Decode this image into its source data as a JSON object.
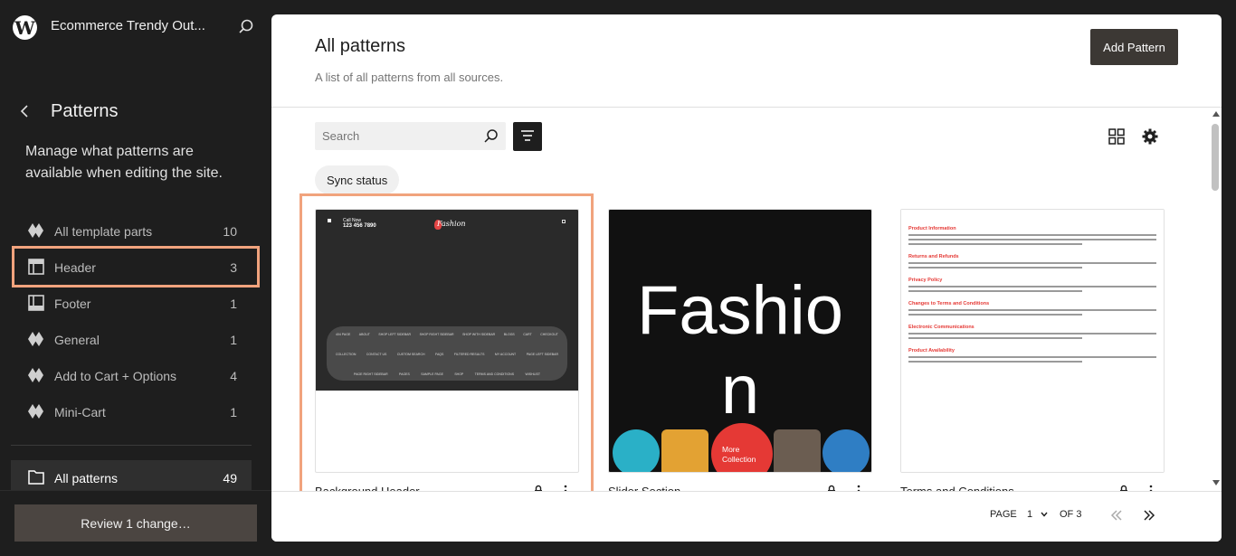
{
  "site": {
    "title": "Ecommerce Trendy Out..."
  },
  "panel": {
    "title": "Patterns",
    "description": "Manage what patterns are available when editing the site."
  },
  "nav": {
    "items": [
      {
        "label": "All template parts",
        "count": "10",
        "icon": "diamond-icon"
      },
      {
        "label": "Header",
        "count": "3",
        "icon": "header-layout-icon"
      },
      {
        "label": "Footer",
        "count": "1",
        "icon": "footer-layout-icon"
      },
      {
        "label": "General",
        "count": "1",
        "icon": "diamond-icon"
      },
      {
        "label": "Add to Cart + Options",
        "count": "4",
        "icon": "diamond-icon"
      },
      {
        "label": "Mini-Cart",
        "count": "1",
        "icon": "diamond-icon"
      }
    ],
    "all_patterns": {
      "label": "All patterns",
      "count": "49",
      "icon": "folder-icon"
    }
  },
  "review_button": "Review 1 change…",
  "main": {
    "title": "All patterns",
    "description": "A list of all patterns from all sources.",
    "add_button": "Add Pattern",
    "search_placeholder": "Search",
    "sync_chip": "Sync status"
  },
  "cards": [
    {
      "title": "Background Header",
      "preview": {
        "call_now": "Call Now",
        "phone": "123 456 7890",
        "logo": "Fashion",
        "menu_rows": [
          [
            "404 PAGE",
            "ABOUT",
            "SHOP LEFT SIDEBAR",
            "SHOP RIGHT SIDEBAR",
            "SHOP WITH SIDEBAR",
            "BLOGS",
            "CART",
            "CHECKOUT"
          ],
          [
            "COLLECTION",
            "CONTACT US",
            "CUSTOM SEARCH",
            "FAQS",
            "FILTERED RESULTS",
            "MY ACCOUNT",
            "PAGE LEFT SIDEBAR"
          ],
          [
            "PAGE RIGHT SIDEBAR",
            "PAGES",
            "SAMPLE PAGE",
            "SHOP",
            "TERMS AND CONDITIONS",
            "WISHLIST"
          ]
        ]
      }
    },
    {
      "title": "Slider Section",
      "preview": {
        "word_line1": "Fashio",
        "word_line2": "n",
        "more": "More Collection"
      }
    },
    {
      "title": "Terms and Conditions",
      "preview": {
        "sections": [
          "Product Information",
          "Returns and Refunds",
          "Privacy Policy",
          "Changes to Terms and Conditions",
          "Electronic Communications",
          "Product Availability"
        ]
      }
    }
  ],
  "pagination": {
    "page_label": "PAGE",
    "current_page": "1",
    "of_label": "OF 3"
  },
  "colors": {
    "highlight": "#f1a37d",
    "accent_dark": "#3c3834",
    "terms_heading": "#e53935"
  }
}
